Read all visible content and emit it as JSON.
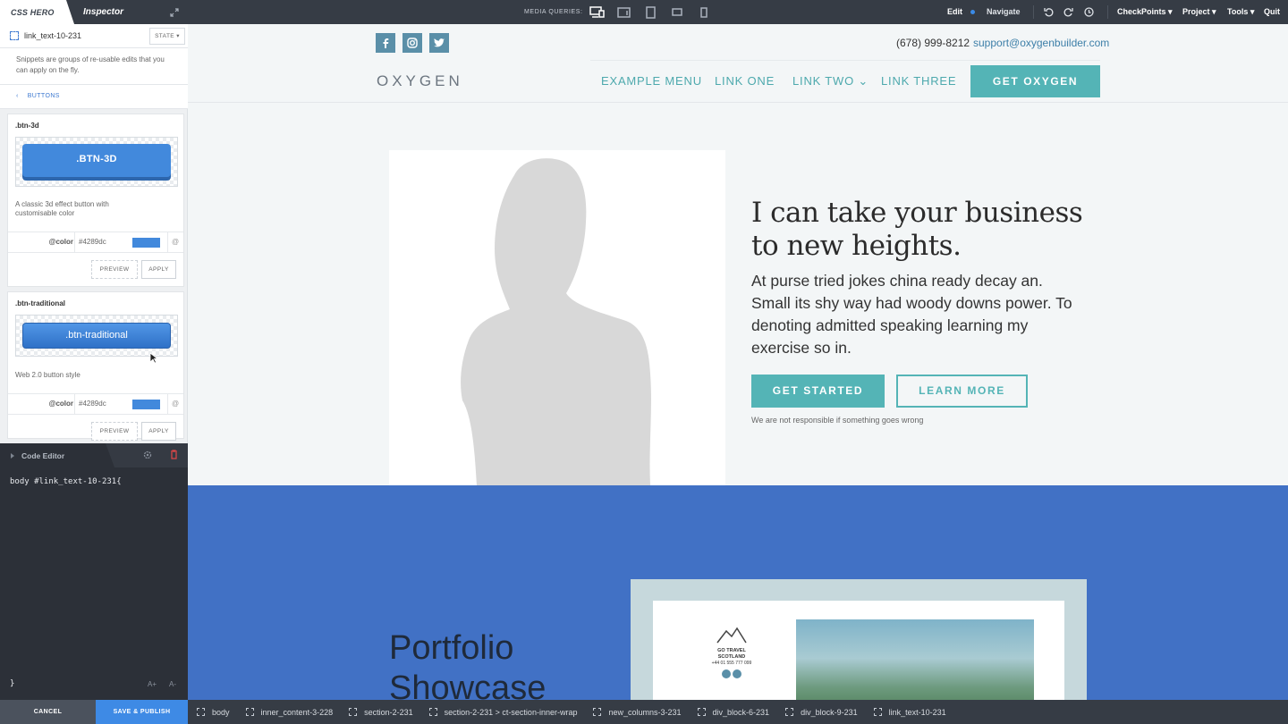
{
  "topbar": {
    "brand": "CSS HERO",
    "inspector_tab": "Inspector",
    "media_queries_label": "MEDIA QUERIES:",
    "edit": "Edit",
    "navigate": "Navigate",
    "checkpoints": "CheckPoints ▾",
    "project": "Project ▾",
    "tools": "Tools ▾",
    "quit": "Quit"
  },
  "sidebar": {
    "selector_name": "link_text-10-231",
    "state_label": "STATE ▾",
    "description": "Snippets are groups of re-usable edits that you can apply on the fly.",
    "breadcrumb": "BUTTONS",
    "snippets": [
      {
        "title": ".btn-3d",
        "button_label": ".BTN-3D",
        "description": "A classic 3d effect button with customisable color",
        "var_name": "@color",
        "var_value": "#4289dc",
        "swatch": "#4289dc",
        "at": "@",
        "preview": "PREVIEW",
        "apply": "APPLY"
      },
      {
        "title": ".btn-traditional",
        "button_label": ".btn-traditional",
        "description": "Web 2.0 button style",
        "var_name": "@color",
        "var_value": "#4289dc",
        "swatch": "#4289dc",
        "at": "@",
        "preview": "PREVIEW",
        "apply": "APPLY"
      }
    ]
  },
  "code_editor": {
    "title": "Code Editor",
    "line1": "body #link_text-10-231{",
    "line_end": "}",
    "zoom_in": "A+",
    "zoom_out": "A-"
  },
  "bottombar": {
    "cancel": "CANCEL",
    "save": "SAVE & PUBLISH",
    "crumbs": [
      "body",
      "inner_content-3-228",
      "section-2-231",
      "section-2-231 > ct-section-inner-wrap",
      "new_columns-3-231",
      "div_block-6-231",
      "div_block-9-231",
      "link_text-10-231"
    ]
  },
  "site": {
    "phone": "(678) 999-8212",
    "email": "support@oxygenbuilder.com",
    "brand": "OXYGEN",
    "nav": [
      "EXAMPLE MENU",
      "LINK ONE",
      "LINK TWO ⌄",
      "LINK THREE"
    ],
    "cta": "GET OXYGEN",
    "hero_title": "I can take your business to new heights.",
    "hero_lead": "At purse tried jokes china ready decay an. Small its shy way had woody downs power. To denoting admitted speaking learning my exercise so in.",
    "btn_start": "GET STARTED",
    "btn_learn": "LEARN MORE",
    "disclaimer": "We are not responsible if something goes wrong",
    "portfolio_title": "Portfolio Showcase",
    "travel_name": "GO TRAVEL SCOTLAND",
    "travel_phone": "+44 01 555 777 099"
  },
  "colors": {
    "accent": "#54b4b6",
    "brand_blue": "#4171c5",
    "ui_dark": "#363c45",
    "save_blue": "#3e8ae5"
  }
}
